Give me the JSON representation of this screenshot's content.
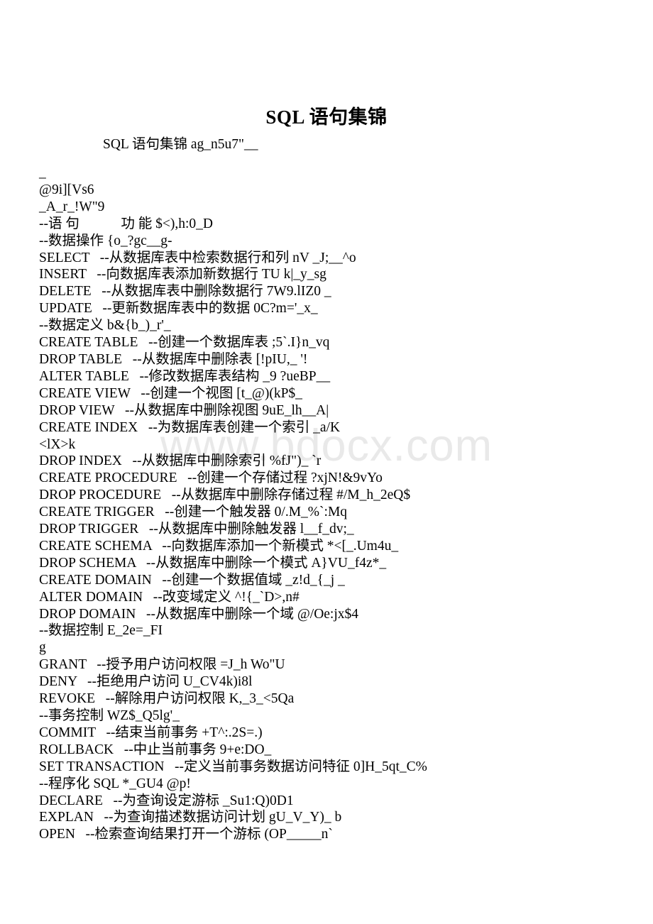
{
  "document": {
    "title": "SQL 语句集锦",
    "intro_line": "SQL 语句集锦 ag_n5u7\"__",
    "watermark": "www.bdocx.com",
    "lines": [
      "_",
      "@9i][Vs6",
      "_A_r_!W\"9",
      "--语 句            功 能 $<),h:0_D",
      "--数据操作 {o_?gc__g-",
      "SELECT   --从数据库表中检索数据行和列 nV _J;__^o",
      "INSERT   --向数据库表添加新数据行 TU k|_y_sg",
      "DELETE   --从数据库表中删除数据行 7W9.lIZ0 _",
      "UPDATE   --更新数据库表中的数据 0C?m='_x_",
      "--数据定义 b&{b_)_r'_",
      "CREATE TABLE   --创建一个数据库表 ;5`.I}n_vq",
      "DROP TABLE   --从数据库中删除表 [!pIU,_ '!",
      "ALTER TABLE   --修改数据库表结构 _9 ?ueBP__",
      "CREATE VIEW   --创建一个视图 [t_@)(kP$_",
      "DROP VIEW   --从数据库中删除视图 9uE_lh__A|",
      "CREATE INDEX   --为数据库表创建一个索引 _a/K",
      "<lX>k",
      "DROP INDEX   --从数据库中删除索引 %fJ\")_ `r",
      "CREATE PROCEDURE   --创建一个存储过程 ?xjN!&9vYo",
      "DROP PROCEDURE   --从数据库中删除存储过程 #/M_h_2eQ$",
      "CREATE TRIGGER   --创建一个触发器 0/.M_%`:Mq",
      "DROP TRIGGER   --从数据库中删除触发器 l__f_dv;_",
      "CREATE SCHEMA   --向数据库添加一个新模式 *<[_.Um4u_",
      "DROP SCHEMA   --从数据库中删除一个模式 A}VU_f4z*_",
      "CREATE DOMAIN   --创建一个数据值域 _z!d_{_j _",
      "ALTER DOMAIN   --改变域定义 ^!{_`D>,n#",
      "DROP DOMAIN   --从数据库中删除一个域 @/Oe:jx$4",
      "--数据控制 E_2e=_FI",
      "g",
      "GRANT   --授予用户访问权限 =J_h Wo\"U",
      "DENY   --拒绝用户访问 U_CV4k)i8l",
      "REVOKE   --解除用户访问权限 K,_3_<5Qa",
      "--事务控制 WZ$_Q5lg'_",
      "COMMIT   --结束当前事务 +T^:.2S=.)",
      "ROLLBACK   --中止当前事务 9+e:DO_",
      "SET TRANSACTION   --定义当前事务数据访问特征 0]H_5qt_C%",
      "--程序化 SQL *_GU4 @p!",
      "DECLARE   --为查询设定游标 _Su1:Q)0D1",
      "EXPLAN   --为查询描述数据访问计划 gU_V_Y)_ b",
      "OPEN   --检索查询结果打开一个游标 (OP_____n`"
    ]
  },
  "colors": {
    "page_background": "#ffffff",
    "text": "#000000",
    "watermark": "#e9e9e9"
  }
}
